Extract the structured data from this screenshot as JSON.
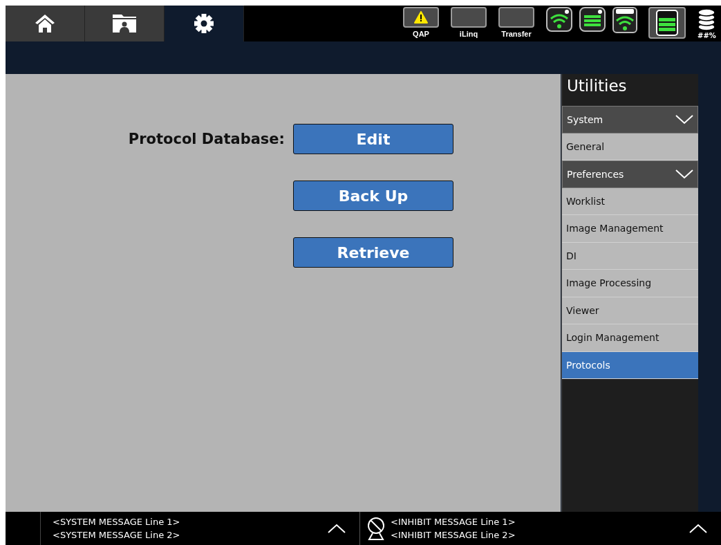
{
  "nav_tabs": [
    {
      "kind": "home",
      "selected": false
    },
    {
      "kind": "folder",
      "selected": false
    },
    {
      "kind": "settings",
      "selected": true
    }
  ],
  "status_buttons": [
    {
      "label": "QAP",
      "kind": "warning"
    },
    {
      "label": "iLinq",
      "kind": "blank"
    },
    {
      "label": "Transfer",
      "kind": "blank"
    }
  ],
  "storage_label": "##%",
  "protocol_database": {
    "label": "Protocol Database:",
    "buttons": [
      "Edit",
      "Back Up",
      "Retrieve"
    ]
  },
  "sidebar": {
    "title": "Utilities",
    "groups": [
      {
        "label": "System",
        "expanded": true,
        "children": [
          {
            "label": "General",
            "selected": false
          }
        ]
      },
      {
        "label": "Preferences",
        "expanded": true,
        "children": [
          {
            "label": "Worklist",
            "selected": false
          },
          {
            "label": "Image Management",
            "selected": false
          },
          {
            "label": "DI",
            "selected": false
          },
          {
            "label": "Image Processing",
            "selected": false
          },
          {
            "label": "Viewer",
            "selected": false
          },
          {
            "label": "Login Management",
            "selected": false
          },
          {
            "label": "Protocols",
            "selected": true
          }
        ]
      }
    ]
  },
  "status_bar": {
    "system_messages": [
      "<SYSTEM MESSAGE Line 1>",
      "<SYSTEM MESSAGE Line 2>"
    ],
    "inhibit_messages": [
      "<INHIBIT MESSAGE Line 1>",
      "<INHIBIT MESSAGE Line 2>"
    ]
  }
}
